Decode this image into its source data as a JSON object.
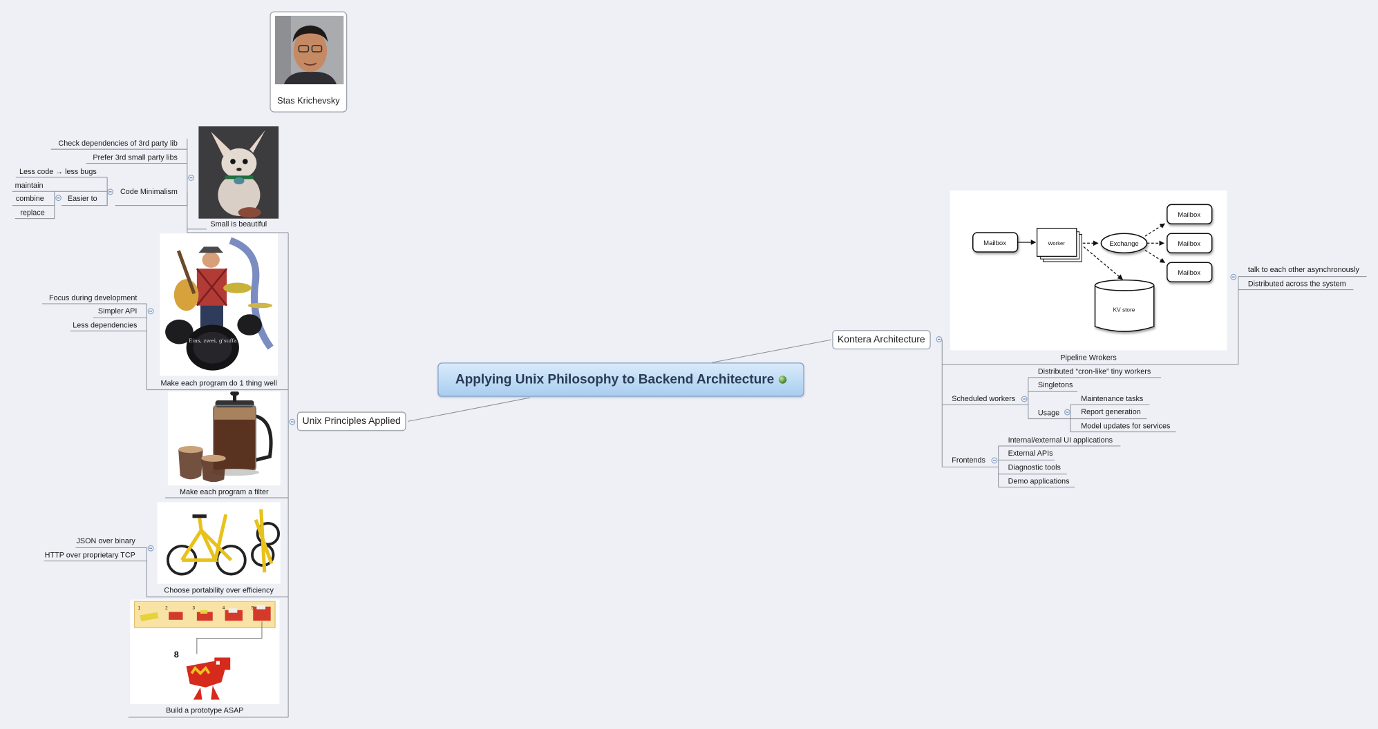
{
  "central": {
    "title": "Applying Unix Philosophy to Backend Architecture",
    "icon": "globe-icon"
  },
  "author": {
    "name": "Stas Krichevsky"
  },
  "unix": {
    "label": "Unix Principles Applied",
    "small": {
      "label": "Small is beautiful",
      "check": "Check dependencies of 3rd party lib",
      "prefer": "Prefer 3rd small party libs",
      "minimalism": "Code Minimalism",
      "less_code": "Less code → less bugs",
      "easier": "Easier to",
      "maintain": "maintain",
      "combine": "combine",
      "replace": "replace"
    },
    "one_thing": {
      "label": "Make each program do 1 thing well",
      "focus": "Focus during development",
      "api": "Simpler API",
      "deps": "Less dependencies",
      "drum_text": "Eins, zwei, g'suffa"
    },
    "filter": {
      "label": "Make each program a filter"
    },
    "portability": {
      "label": "Choose portability over efficiency",
      "json": "JSON over binary",
      "http": "HTTP over proprietary TCP"
    },
    "prototype": {
      "label": "Build a prototype ASAP",
      "steps": [
        "1",
        "2",
        "3",
        "4",
        "5"
      ],
      "final_step": "8"
    }
  },
  "kontera": {
    "label": "Kontera Architecture",
    "pipeline": {
      "label": "Pipeline Wrokers",
      "talk": "talk to each other asynchronously",
      "distributed": "Distributed across the system",
      "diagram": {
        "mailbox_in": "Mailbox",
        "worker": "Worker",
        "exchange": "Exchange",
        "mailbox_out": [
          "Mailbox",
          "Mailbox",
          "Mailbox"
        ],
        "kv": "KV store"
      }
    },
    "scheduled": {
      "label": "Scheduled workers",
      "cron": "Distributed “cron-like” tiny workers",
      "singletons": "Singletons",
      "usage": "Usage",
      "maintenance": "Maintenance tasks",
      "report": "Report generation",
      "model": "Model updates for services"
    },
    "frontends": {
      "label": "Frontends",
      "internal": "Internal/external UI applications",
      "apis": "External APIs",
      "diag": "Diagnostic tools",
      "demo": "Demo applications"
    }
  }
}
